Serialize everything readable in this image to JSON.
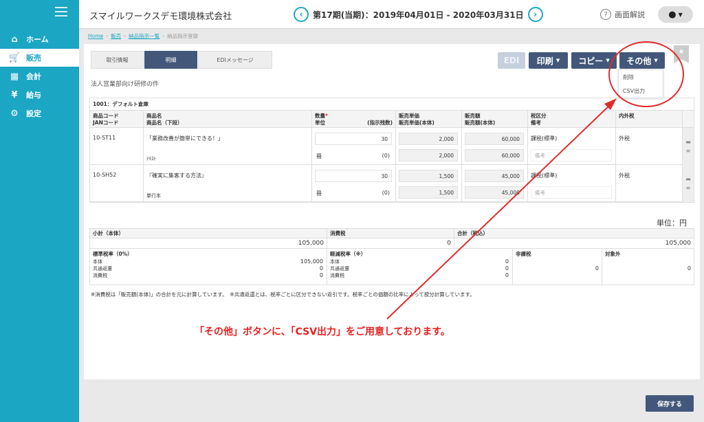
{
  "sidebar": {
    "items": [
      {
        "label": "ホーム",
        "icon": "home-icon"
      },
      {
        "label": "販売",
        "icon": "cart-icon"
      },
      {
        "label": "会計",
        "icon": "calculator-icon"
      },
      {
        "label": "給与",
        "icon": "money-bag-icon"
      },
      {
        "label": "設定",
        "icon": "gear-icon"
      }
    ]
  },
  "header": {
    "company": "スマイルワークスデモ環境株式会社",
    "period": "第17期(当期)：2019年04月01日 - 2020年03月31日",
    "help": "画面解説"
  },
  "breadcrumb": [
    "Home",
    "販売",
    "納品指示一覧",
    "納品指示登録"
  ],
  "tabs": [
    "取引情報",
    "明細",
    "EDIメッセージ"
  ],
  "actions": {
    "edi": "EDI",
    "print": "印刷",
    "copy": "コピー",
    "other": "その他"
  },
  "dropdown": [
    "削除",
    "CSV出力"
  ],
  "subject": "法人営業部向け研修の件",
  "warehouse": "1001：デフォルト倉庫",
  "columns": {
    "code": [
      "商品コード",
      "JANコード"
    ],
    "name": [
      "商品名",
      "商品名（下段）"
    ],
    "qty": [
      "数量",
      "単位",
      "(指示残数)"
    ],
    "price": [
      "販売単価",
      "販売単価(本体)"
    ],
    "amount": [
      "販売額",
      "販売額(本体)"
    ],
    "tax": [
      "税区分",
      "備考"
    ],
    "taxin": "内外税"
  },
  "items": [
    {
      "code": "10-ST11",
      "name": "「業務改善が簡単にできる！」",
      "sub": "ﾃｷｽﾄ",
      "qty": "30",
      "unit": "冊",
      "remain": "(0)",
      "price": "2,000",
      "price_net": "2,000",
      "amount": "60,000",
      "amount_net": "60,000",
      "tax": "課税(標準)",
      "remark": "備考",
      "taxin": "外税"
    },
    {
      "code": "10-SH52",
      "name": "『確実に集客する方法』",
      "sub": "単行本",
      "qty": "30",
      "unit": "冊",
      "remain": "(0)",
      "price": "1,500",
      "price_net": "1,500",
      "amount": "45,000",
      "amount_net": "45,000",
      "tax": "課税(標準)",
      "remark": "備考",
      "taxin": "外税"
    }
  ],
  "unit_label": "単位：円",
  "summary": {
    "subtotal_label": "小計（本体）",
    "tax_label": "消費税",
    "total_label": "合計（税込）",
    "subtotal": "105,000",
    "tax": "0",
    "total": "105,000",
    "std": {
      "title": "標準税率（0%）",
      "lines": [
        [
          "本体",
          "105,000"
        ],
        [
          "共通返還",
          "0"
        ],
        [
          "消費税",
          "0"
        ]
      ]
    },
    "reduced": {
      "title": "軽減税率（※）",
      "lines": [
        [
          "本体",
          "0"
        ],
        [
          "共通返還",
          "0"
        ],
        [
          "消費税",
          "0"
        ]
      ]
    },
    "nontax": {
      "title": "非課税",
      "value": "0"
    },
    "exempt": {
      "title": "対象外",
      "value": "0"
    }
  },
  "note": "※消費税は「販売額(本体)」の合計を元に計算しています。　※共通返還とは、税率ごとに区分できない返引です。税率ごとの価額の比率によって按分計算しています。",
  "annotation": "「その他」ボタンに、「CSV出力」をご用意しております。",
  "save": "保存する",
  "colors": {
    "accent": "#1ba6c4",
    "navy": "#43577a",
    "annotation": "#e82020"
  }
}
